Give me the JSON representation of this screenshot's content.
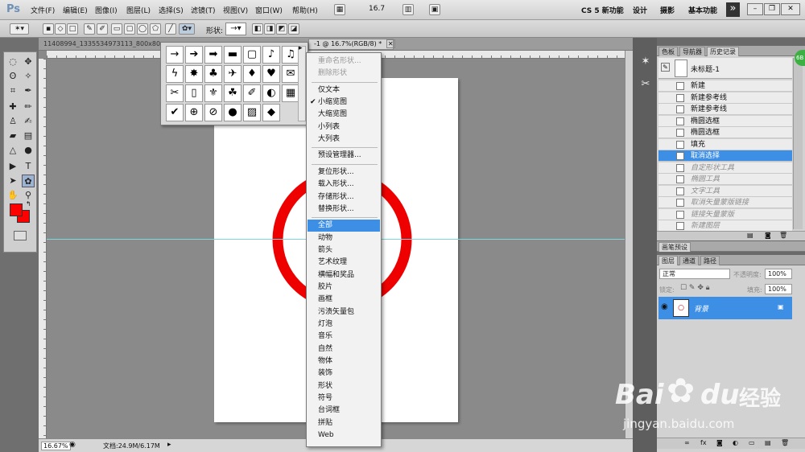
{
  "app": {
    "logo": "Ps"
  },
  "menubar": {
    "items": [
      "文件(F)",
      "编辑(E)",
      "图像(I)",
      "图层(L)",
      "选择(S)",
      "滤镜(T)",
      "视图(V)",
      "窗口(W)",
      "帮助(H)"
    ],
    "zoom": "16.7",
    "workspaces": [
      "CS 5 新功能",
      "设计",
      "摄影",
      "基本功能"
    ],
    "more": "»"
  },
  "options_bar": {
    "shape_label": "形状:"
  },
  "tabs": {
    "doc1": "11408994_1335534973113_800x80",
    "doc2": "-1 @ 16.7%(RGB/8) *"
  },
  "status": {
    "zoom": "16.67%",
    "doc_info": "文档:24.9M/6.17M"
  },
  "shape_picker": {
    "shapes": [
      "→",
      "➔",
      "➡",
      "▬",
      "▢",
      "♪",
      "♫",
      "ϟ",
      "✸",
      "♣",
      "✈",
      "♦",
      "♥",
      "✉",
      "✂",
      "▯",
      "⚜",
      "☘",
      "✐",
      "◐",
      "▦",
      "✔",
      "⊕",
      "⊘",
      "●",
      "▨",
      "◆"
    ]
  },
  "dropdown": {
    "items": [
      {
        "label": "重命名形状...",
        "state": "dis"
      },
      {
        "label": "删除形状",
        "state": "dis"
      },
      {
        "label": "仅文本",
        "state": ""
      },
      {
        "label": "小缩览图",
        "state": "check"
      },
      {
        "label": "大缩览图",
        "state": ""
      },
      {
        "label": "小列表",
        "state": ""
      },
      {
        "label": "大列表",
        "state": ""
      },
      {
        "label": "预设管理器...",
        "state": ""
      },
      {
        "label": "复位形状...",
        "state": ""
      },
      {
        "label": "载入形状...",
        "state": ""
      },
      {
        "label": "存储形状...",
        "state": ""
      },
      {
        "label": "替换形状...",
        "state": ""
      },
      {
        "label": "全部",
        "state": "sel"
      },
      {
        "label": "动物",
        "state": ""
      },
      {
        "label": "箭头",
        "state": ""
      },
      {
        "label": "艺术纹理",
        "state": ""
      },
      {
        "label": "横幅和奖品",
        "state": ""
      },
      {
        "label": "胶片",
        "state": ""
      },
      {
        "label": "画框",
        "state": ""
      },
      {
        "label": "污渍矢量包",
        "state": ""
      },
      {
        "label": "灯泡",
        "state": ""
      },
      {
        "label": "音乐",
        "state": ""
      },
      {
        "label": "自然",
        "state": ""
      },
      {
        "label": "物体",
        "state": ""
      },
      {
        "label": "装饰",
        "state": ""
      },
      {
        "label": "形状",
        "state": ""
      },
      {
        "label": "符号",
        "state": ""
      },
      {
        "label": "台词框",
        "state": ""
      },
      {
        "label": "拼贴",
        "state": ""
      },
      {
        "label": "Web",
        "state": ""
      }
    ]
  },
  "panels": {
    "top_tabs": [
      "色板",
      "导航器",
      "历史记录"
    ],
    "snapshot_name": "未标题-1",
    "history": [
      {
        "label": "新建",
        "state": ""
      },
      {
        "label": "新建参考线",
        "state": ""
      },
      {
        "label": "新建参考线",
        "state": ""
      },
      {
        "label": "椭圆选框",
        "state": ""
      },
      {
        "label": "椭圆选框",
        "state": ""
      },
      {
        "label": "填充",
        "state": ""
      },
      {
        "label": "取消选择",
        "state": "sel"
      },
      {
        "label": "自定形状工具",
        "state": "dis"
      },
      {
        "label": "椭圆工具",
        "state": "dis"
      },
      {
        "label": "文字工具",
        "state": "dis"
      },
      {
        "label": "取消矢量蒙版链接",
        "state": "dis"
      },
      {
        "label": "链接矢量蒙版",
        "state": "dis"
      },
      {
        "label": "新建图层",
        "state": "dis"
      }
    ],
    "brush_tab": "画笔预设",
    "layer_tabs": [
      "图层",
      "通道",
      "路径"
    ],
    "blend_mode": "正常",
    "opacity_label": "不透明度:",
    "opacity": "100%",
    "lock_label": "锁定:",
    "fill_label": "填充:",
    "fill": "100%",
    "layer_name": "背景"
  },
  "watermark": {
    "brand": "Bai",
    "brand2": "du",
    "cn": "经验",
    "url": "jingyan.baidu.com"
  },
  "colors": {
    "foreground": "#ff0000",
    "background": "#ff0000",
    "ring": "#ee0000",
    "selection": "#3d8fe6",
    "guide": "#7fd6e0"
  }
}
